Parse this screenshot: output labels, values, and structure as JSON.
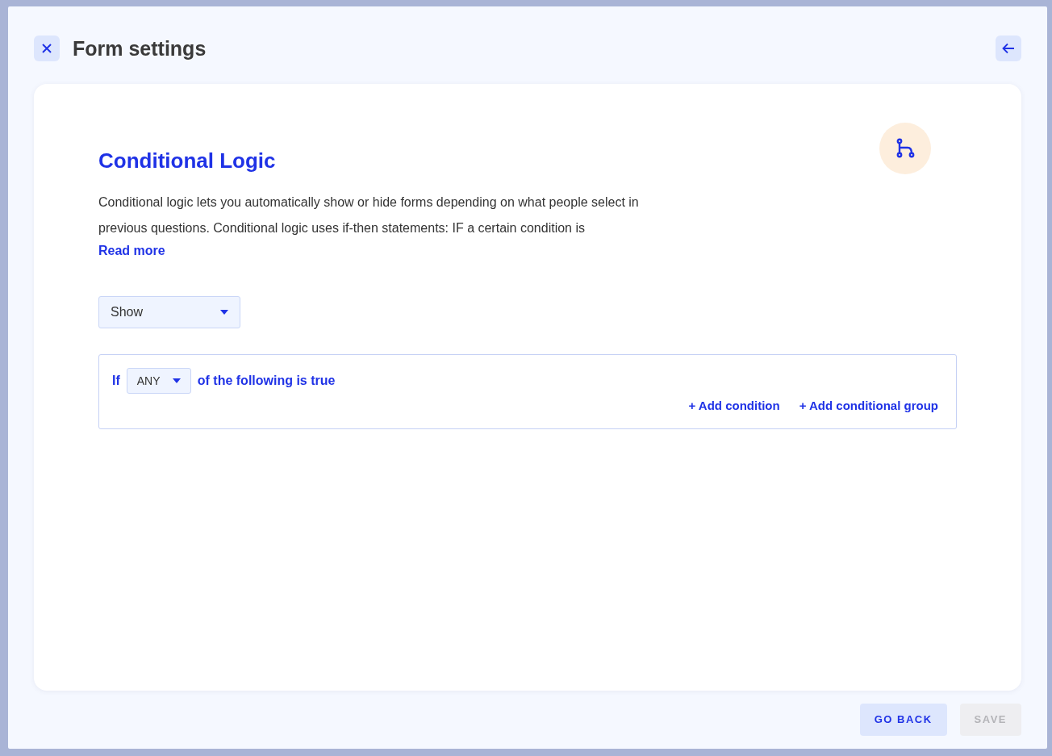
{
  "window": {
    "title": "Form settings"
  },
  "section": {
    "title": "Conditional Logic",
    "description": "Conditional logic lets you automatically show or hide forms depending on what people select in previous questions. Conditional logic uses if-then statements: IF a certain condition is",
    "read_more": "Read more"
  },
  "action_select": {
    "value": "Show"
  },
  "rule": {
    "prefix": "If",
    "match_select": {
      "value": "ANY"
    },
    "suffix": "of the following is true",
    "links": [
      "+ Add condition",
      "+ Add conditional group"
    ]
  },
  "footer_buttons": [
    {
      "label": "GO BACK",
      "disabled": false
    },
    {
      "label": "SAVE",
      "disabled": true
    }
  ]
}
